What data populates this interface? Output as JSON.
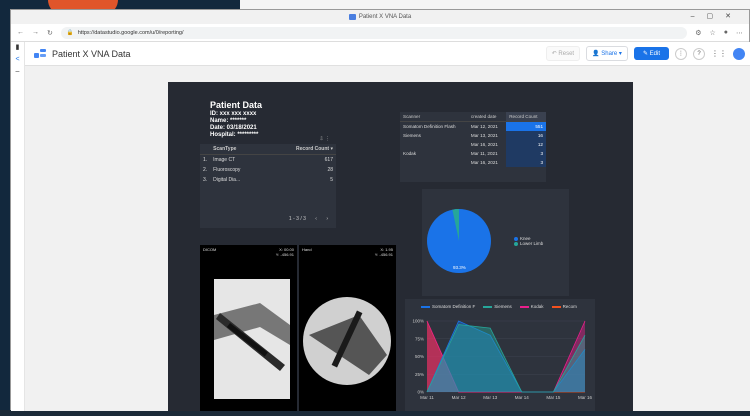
{
  "browser": {
    "tab_title": "Patient X VNA Data",
    "url": "https://datastudio.google.com/u/0/reporting/"
  },
  "app": {
    "title": "Patient X VNA Data",
    "reset_label": "Reset",
    "share_label": "Share",
    "edit_label": "Edit"
  },
  "patient": {
    "heading": "Patient Data",
    "id": "ID: xxx xxx xxxx",
    "name": "Name: *******",
    "date": "Date: 03/18/2021",
    "hospital": "Hospital: *********"
  },
  "scan_table": {
    "headers": [
      "ScanType",
      "Record Count"
    ],
    "rows": [
      {
        "idx": "1.",
        "type": "Image CT",
        "count": "617"
      },
      {
        "idx": "2.",
        "type": "Fluoroscopy",
        "count": "28"
      },
      {
        "idx": "3.",
        "type": "Digital Dia...",
        "count": "5"
      }
    ],
    "pager": "1 - 3 / 3"
  },
  "vna_table": {
    "headers": [
      "Scanner",
      "created date",
      "Record Count"
    ],
    "rows": [
      {
        "scanner": "Somatom Definition Flash",
        "date": "Mar 12, 2021",
        "count": "551"
      },
      {
        "scanner": "Siemens",
        "date": "Mar 13, 2021",
        "count": "16"
      },
      {
        "scanner": "",
        "date": "Mar 16, 2021",
        "count": "12"
      },
      {
        "scanner": "Kodak",
        "date": "Mar 11, 2021",
        "count": "3"
      },
      {
        "scanner": "",
        "date": "Mar 16, 2021",
        "count": "3"
      }
    ]
  },
  "pie": {
    "legend": [
      "Knee",
      "Lower Limb"
    ],
    "label": "93.3%"
  },
  "xray": {
    "left_tag": "DICOM",
    "left_coords": [
      "X: 00.00",
      "Y: -456.91"
    ],
    "right_tag": "Hand",
    "right_coords": [
      "X: 1.95",
      "Y: -456.91"
    ]
  },
  "colors": {
    "blue": "#1a73e8",
    "teal": "#26a69a",
    "magenta": "#e91e8c",
    "orange": "#f4511e"
  },
  "chart_data": {
    "type": "area",
    "categories": [
      "Mar 11",
      "Mar 12",
      "Mar 13",
      "Mar 14",
      "Mar 15",
      "Mar 16"
    ],
    "series": [
      {
        "name": "Somatom Definition F",
        "values": [
          0,
          100,
          80,
          0,
          0,
          60
        ]
      },
      {
        "name": "Siemens",
        "values": [
          0,
          95,
          90,
          0,
          0,
          80
        ]
      },
      {
        "name": "Kodak",
        "values": [
          100,
          0,
          0,
          0,
          0,
          100
        ]
      },
      {
        "name": "Recom",
        "values": [
          100,
          0,
          0,
          0,
          0,
          0
        ]
      }
    ],
    "ylim": [
      0,
      100
    ],
    "yticks": [
      "0%",
      "25%",
      "50%",
      "75%",
      "100%"
    ]
  }
}
